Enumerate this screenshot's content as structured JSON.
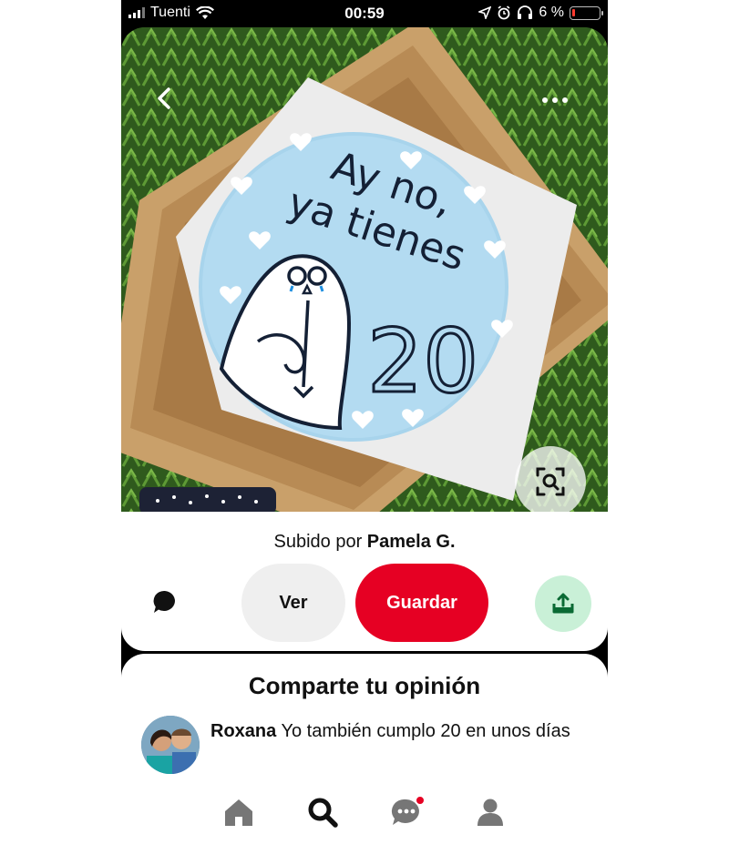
{
  "status_bar": {
    "carrier": "Tuenti",
    "time": "00:59",
    "battery_percent": "6 %",
    "battery_color": "#ff3b30"
  },
  "pin": {
    "image_description_icon": "cake-photo",
    "cake_text": [
      "Ay no,",
      "ya tienes",
      "20"
    ],
    "uploaded_prefix": "Subido por",
    "uploader": "Pamela G.",
    "ver_label": "Ver",
    "save_label": "Guardar",
    "save_color": "#e60023",
    "share_bg_color": "#c9f0d7"
  },
  "comments": {
    "title": "Comparte tu opinión",
    "items": [
      {
        "author": "Roxana",
        "text": "Yo también cumplo 20 en unos días"
      }
    ]
  },
  "bottom_nav": {
    "items": [
      {
        "icon": "home-icon"
      },
      {
        "icon": "search-icon",
        "active": true
      },
      {
        "icon": "messages-icon",
        "badge": true
      },
      {
        "icon": "profile-icon"
      }
    ]
  }
}
